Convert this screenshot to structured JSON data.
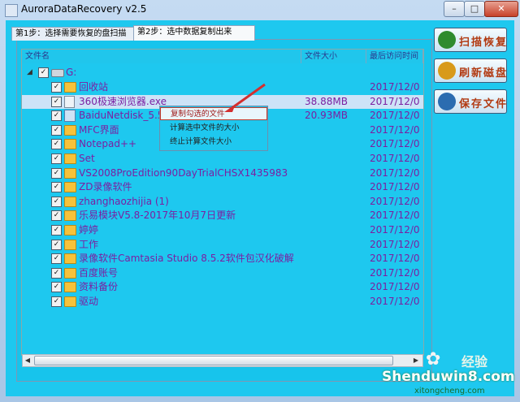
{
  "window": {
    "title": "AuroraDataRecovery v2.5",
    "controls": {
      "minimize": "–",
      "maximize": "□",
      "close": "✕"
    }
  },
  "tabs": [
    {
      "label": "第1步：选择需要恢复的盘扫描"
    },
    {
      "label": "第2步：选中数据复制出来"
    }
  ],
  "columns": {
    "name": "文件名",
    "size": "文件大小",
    "last_access": "最后访问时间"
  },
  "tree": {
    "drive": {
      "label": "G:"
    },
    "rows": [
      {
        "name": "回收站",
        "size": "",
        "date": "2017/12/0",
        "type": "folder"
      },
      {
        "name": "360极速浏览器.exe",
        "size": "38.88MB",
        "date": "2017/12/0",
        "type": "file"
      },
      {
        "name": "BaiduNetdisk_5.5",
        "size": "20.93MB",
        "date": "2017/12/0",
        "type": "file"
      },
      {
        "name": "MFC界面",
        "size": "",
        "date": "2017/12/0",
        "type": "folder"
      },
      {
        "name": "Notepad++",
        "size": "",
        "date": "2017/12/0",
        "type": "folder"
      },
      {
        "name": "Set",
        "size": "",
        "date": "2017/12/0",
        "type": "folder"
      },
      {
        "name": "VS2008ProEdition90DayTrialCHSX1435983",
        "size": "",
        "date": "2017/12/0",
        "type": "folder"
      },
      {
        "name": "ZD录像软件",
        "size": "",
        "date": "2017/12/0",
        "type": "folder"
      },
      {
        "name": "zhanghaozhijia (1)",
        "size": "",
        "date": "2017/12/0",
        "type": "folder"
      },
      {
        "name": "乐易模块V5.8-2017年10月7日更新",
        "size": "",
        "date": "2017/12/0",
        "type": "folder"
      },
      {
        "name": "婷婷",
        "size": "",
        "date": "2017/12/0",
        "type": "folder"
      },
      {
        "name": "工作",
        "size": "",
        "date": "2017/12/0",
        "type": "folder"
      },
      {
        "name": "录像软件Camtasia Studio 8.5.2软件包汉化破解",
        "size": "",
        "date": "2017/12/0",
        "type": "folder"
      },
      {
        "name": "百度账号",
        "size": "",
        "date": "2017/12/0",
        "type": "folder"
      },
      {
        "name": "资料备份",
        "size": "",
        "date": "2017/12/0",
        "type": "folder"
      },
      {
        "name": "驱动",
        "size": "",
        "date": "2017/12/0",
        "type": "folder"
      }
    ]
  },
  "context_menu": {
    "items": [
      {
        "label": "复制勾选的文件"
      },
      {
        "label": "计算选中文件的大小"
      },
      {
        "label": "终止计算文件大小"
      }
    ]
  },
  "side_buttons": [
    {
      "label": "扫描恢复",
      "icon": "magnifier-icon",
      "color": "#2e8b2e"
    },
    {
      "label": "刷新磁盘",
      "icon": "refresh-icon",
      "color": "#d89a1a"
    },
    {
      "label": "保存文件",
      "icon": "save-icon",
      "color": "#2b6cb0"
    }
  ],
  "watermark": {
    "cn": "经验",
    "site": "Shenduwin8.com",
    "sub": "xitongcheng.com"
  },
  "colors": {
    "panel_bg": "#1ec8ef",
    "text_purple": "#7b1fa2",
    "header_text": "#2b3a8e",
    "menu_highlight_border": "#c0392b"
  }
}
